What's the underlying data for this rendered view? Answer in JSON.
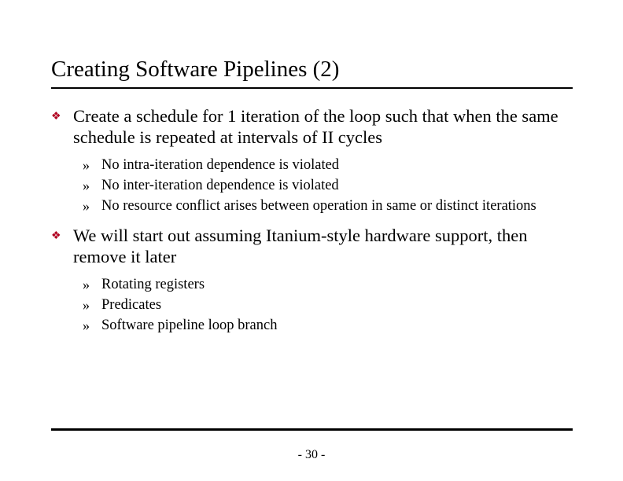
{
  "title": "Creating Software Pipelines (2)",
  "bullets": {
    "b1": {
      "text": "Create a schedule for 1 iteration of the loop such that when the same schedule is repeated at intervals of II cycles",
      "sub": {
        "s1": "No intra-iteration dependence is violated",
        "s2": "No inter-iteration dependence is violated",
        "s3": "No resource conflict arises between operation in same or distinct iterations"
      }
    },
    "b2": {
      "text": "We will start out assuming Itanium-style hardware support, then remove it later",
      "sub": {
        "s1": "Rotating registers",
        "s2": "Predicates",
        "s3": "Software pipeline loop branch"
      }
    }
  },
  "glyphs": {
    "diamond": "❖",
    "raquo": "»"
  },
  "pagenum": "- 30 -"
}
